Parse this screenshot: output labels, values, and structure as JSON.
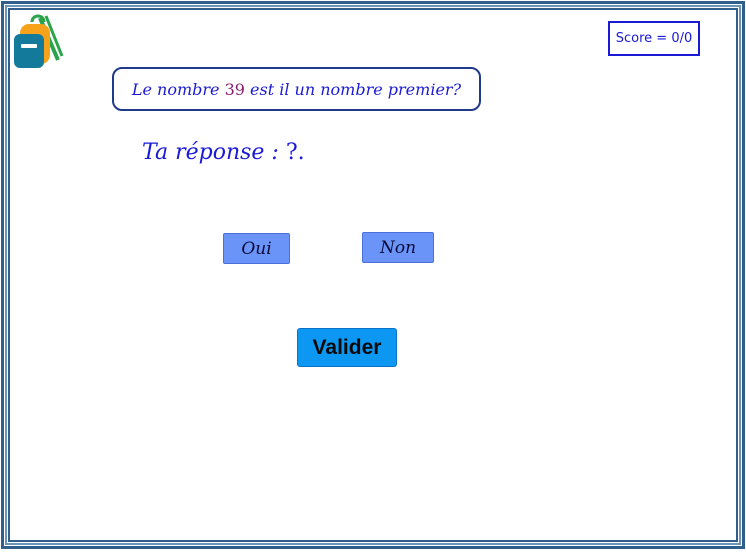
{
  "score": {
    "label": "Score = 0/0"
  },
  "question": {
    "prefix": "Le nombre ",
    "number": "39",
    "suffix": " est il un nombre premier?"
  },
  "answer": {
    "label": "Ta réponse :",
    "value": " ?."
  },
  "choices": {
    "yes_label": "Oui",
    "no_label": "Non"
  },
  "validate": {
    "label": "Valider"
  },
  "logo": {
    "icon": "backpack-icon"
  },
  "colors": {
    "frame": "#2f5f8a",
    "text_blue": "#1a1ad6",
    "number_purple": "#8a1a6e",
    "choice_button": "#6a94f7",
    "validate_button": "#0c97f3"
  }
}
